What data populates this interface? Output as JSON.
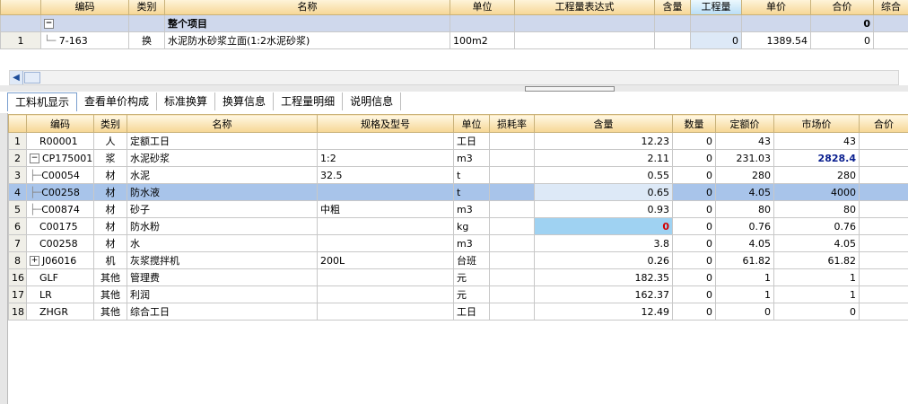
{
  "top_table": {
    "headers": [
      "编码",
      "类别",
      "名称",
      "单位",
      "工程量表达式",
      "含量",
      "工程量",
      "单价",
      "合价",
      "综合"
    ],
    "group_row": {
      "label": "整个项目",
      "total": "0"
    },
    "row": {
      "num": "1",
      "code": "7-163",
      "type": "换",
      "name": "水泥防水砂浆立面(1:2水泥砂浆)",
      "unit": "100m2",
      "qty": "0",
      "price": "1389.54",
      "total": "0"
    }
  },
  "tabs": [
    "工料机显示",
    "查看单价构成",
    "标准换算",
    "换算信息",
    "工程量明细",
    "说明信息"
  ],
  "bottom_table": {
    "headers": [
      "编码",
      "类别",
      "名称",
      "规格及型号",
      "单位",
      "损耗率",
      "含量",
      "数量",
      "定额价",
      "市场价",
      "合价"
    ],
    "rows": [
      {
        "num": "1",
        "code": "R00001",
        "cat": "人",
        "name": "定额工日",
        "spec": "",
        "unit": "工日",
        "amount": "12.23",
        "qty": "0",
        "quota": "43",
        "market": "43"
      },
      {
        "num": "2",
        "code": "CP175001",
        "cat": "浆",
        "name": "水泥砂浆",
        "spec": "1:2",
        "unit": "m3",
        "amount": "2.11",
        "qty": "0",
        "quota": "231.03",
        "market": "2828.4"
      },
      {
        "num": "3",
        "code": "C00054",
        "cat": "材",
        "name": "水泥",
        "spec": "32.5",
        "unit": "t",
        "amount": "0.55",
        "qty": "0",
        "quota": "280",
        "market": "280"
      },
      {
        "num": "4",
        "code": "C00258",
        "cat": "材",
        "name": "防水液",
        "spec": "",
        "unit": "t",
        "amount": "0.65",
        "qty": "0",
        "quota": "4.05",
        "market": "4000"
      },
      {
        "num": "5",
        "code": "C00874",
        "cat": "材",
        "name": "砂子",
        "spec": "中粗",
        "unit": "m3",
        "amount": "0.93",
        "qty": "0",
        "quota": "80",
        "market": "80"
      },
      {
        "num": "6",
        "code": "C00175",
        "cat": "材",
        "name": "防水粉",
        "spec": "",
        "unit": "kg",
        "amount": "0",
        "qty": "0",
        "quota": "0.76",
        "market": "0.76"
      },
      {
        "num": "7",
        "code": "C00258",
        "cat": "材",
        "name": "水",
        "spec": "",
        "unit": "m3",
        "amount": "3.8",
        "qty": "0",
        "quota": "4.05",
        "market": "4.05"
      },
      {
        "num": "8",
        "code": "J06016",
        "cat": "机",
        "name": "灰浆搅拌机",
        "spec": "200L",
        "unit": "台班",
        "amount": "0.26",
        "qty": "0",
        "quota": "61.82",
        "market": "61.82"
      },
      {
        "num": "16",
        "code": "GLF",
        "cat": "其他",
        "name": "管理费",
        "spec": "",
        "unit": "元",
        "amount": "182.35",
        "qty": "0",
        "quota": "1",
        "market": "1"
      },
      {
        "num": "17",
        "code": "LR",
        "cat": "其他",
        "name": "利润",
        "spec": "",
        "unit": "元",
        "amount": "162.37",
        "qty": "0",
        "quota": "1",
        "market": "1"
      },
      {
        "num": "18",
        "code": "ZHGR",
        "cat": "其他",
        "name": "综合工日",
        "spec": "",
        "unit": "工日",
        "amount": "12.49",
        "qty": "0",
        "quota": "0",
        "market": "0"
      }
    ]
  },
  "colors": {
    "header_gold": "#f6d694",
    "selected_row": "#a8c4ea",
    "group_row": "#cfd8ec",
    "red_value": "#d40000",
    "blue_value": "#0a1f8f"
  }
}
